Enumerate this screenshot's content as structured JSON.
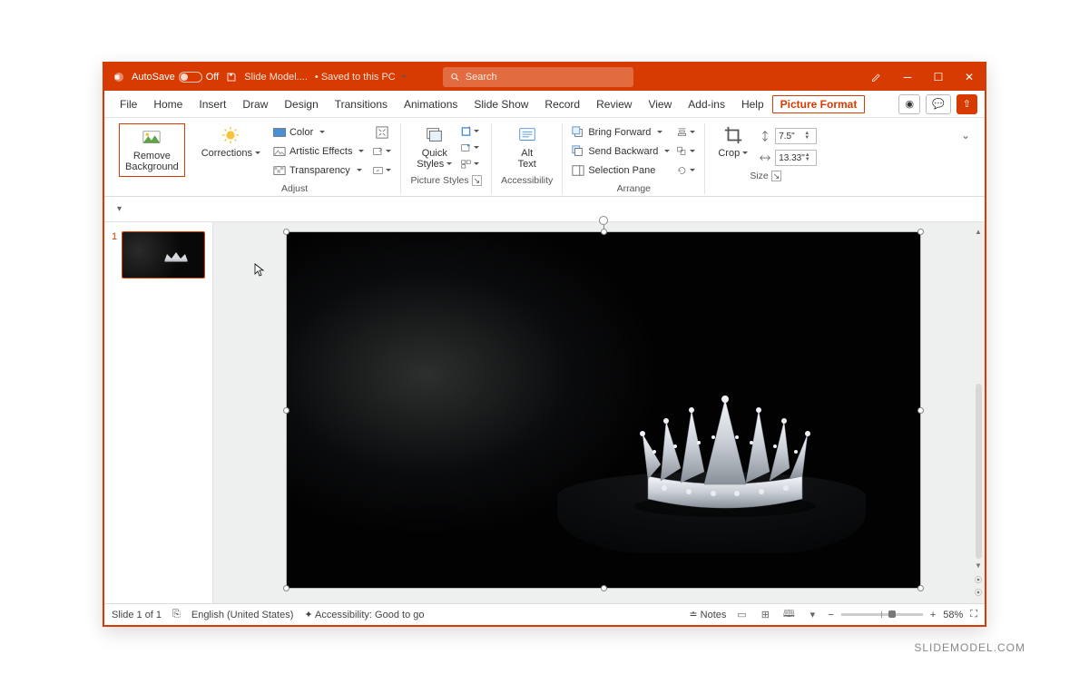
{
  "titlebar": {
    "autosave_label": "AutoSave",
    "autosave_state": "Off",
    "doc_name": "Slide Model....",
    "save_status": "Saved to this PC",
    "search_placeholder": "Search"
  },
  "tabs": {
    "file": "File",
    "home": "Home",
    "insert": "Insert",
    "draw": "Draw",
    "design": "Design",
    "transitions": "Transitions",
    "animations": "Animations",
    "slide_show": "Slide Show",
    "record": "Record",
    "review": "Review",
    "view": "View",
    "addins": "Add-ins",
    "help": "Help",
    "picture_format": "Picture Format"
  },
  "ribbon": {
    "remove_bg_line1": "Remove",
    "remove_bg_line2": "Background",
    "corrections": "Corrections",
    "color": "Color",
    "artistic": "Artistic Effects",
    "transparency": "Transparency",
    "adjust_label": "Adjust",
    "quick_styles_line1": "Quick",
    "quick_styles_line2": "Styles",
    "picture_styles_label": "Picture Styles",
    "alt_line1": "Alt",
    "alt_line2": "Text",
    "accessibility_label": "Accessibility",
    "bring_forward": "Bring Forward",
    "send_backward": "Send Backward",
    "selection_pane": "Selection Pane",
    "arrange_label": "Arrange",
    "crop": "Crop",
    "height_value": "7.5\"",
    "width_value": "13.33\"",
    "size_label": "Size"
  },
  "thumb": {
    "number": "1"
  },
  "status": {
    "slide_info": "Slide 1 of 1",
    "language": "English (United States)",
    "accessibility": "Accessibility: Good to go",
    "notes": "Notes",
    "zoom": "58%"
  },
  "watermark": "SLIDEMODEL.COM"
}
